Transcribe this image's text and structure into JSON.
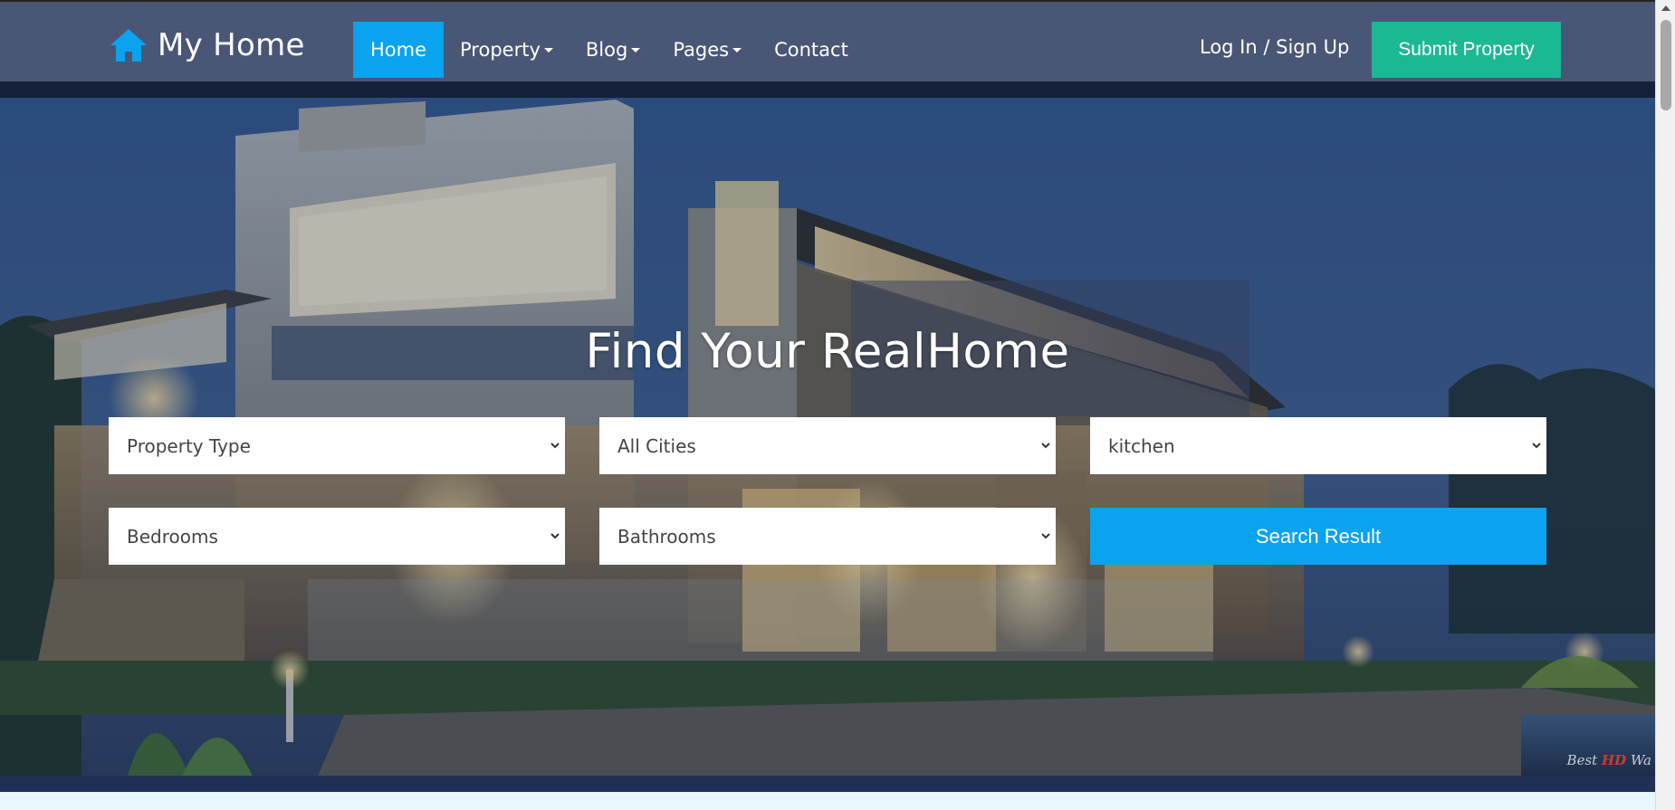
{
  "brand": {
    "name": "My Home",
    "icon": "home-icon",
    "color": "#0aa3f0"
  },
  "nav": {
    "items": [
      {
        "label": "Home",
        "active": true,
        "dropdown": false
      },
      {
        "label": "Property",
        "active": false,
        "dropdown": true
      },
      {
        "label": "Blog",
        "active": false,
        "dropdown": true
      },
      {
        "label": "Pages",
        "active": false,
        "dropdown": true
      },
      {
        "label": "Contact",
        "active": false,
        "dropdown": false
      }
    ],
    "login_label": "Log In / Sign Up",
    "submit_label": "Submit Property"
  },
  "hero": {
    "title": "Find Your RealHome",
    "watermark": "Best",
    "watermark_hd": "HD",
    "watermark_tail": "Wa"
  },
  "search": {
    "property_type": "Property Type",
    "city": "All Cities",
    "keyword": "kitchen",
    "bedrooms": "Bedrooms",
    "bathrooms": "Bathrooms",
    "button_label": "Search Result"
  },
  "colors": {
    "navbar_bg": "#4a5675",
    "accent": "#0aa3f0",
    "submit_green": "#1bb894"
  }
}
